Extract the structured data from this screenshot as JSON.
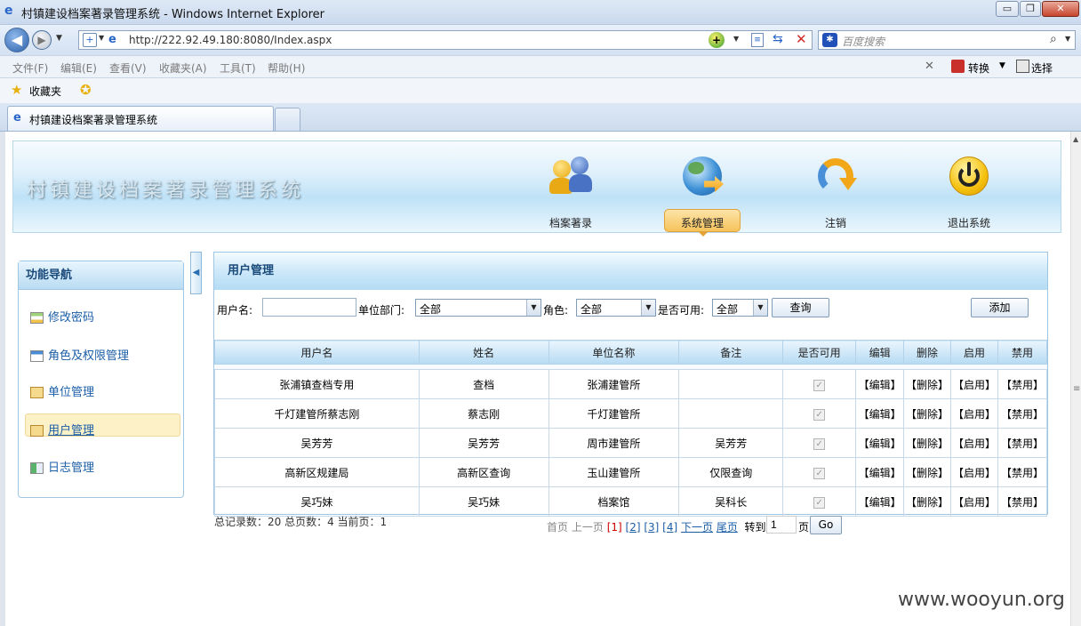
{
  "browser": {
    "window_title": "村镇建设档案著录管理系统 - Windows Internet Explorer",
    "url": "http://222.92.49.180:8080/Index.aspx",
    "search_placeholder": "百度搜索",
    "menu": [
      "文件(F)",
      "编辑(E)",
      "查看(V)",
      "收藏夹(A)",
      "工具(T)",
      "帮助(H)"
    ],
    "convert_label": "转换",
    "select_label": "选择",
    "favorites_label": "收藏夹",
    "tab_title": "村镇建设档案著录管理系统"
  },
  "header": {
    "system_name": "村镇建设档案著录管理系统",
    "nav": [
      {
        "label": "档案著录",
        "icon": "users-icon"
      },
      {
        "label": "系统管理",
        "icon": "globe-icon"
      },
      {
        "label": "注销",
        "icon": "refresh-arrow-icon"
      },
      {
        "label": "退出系统",
        "icon": "power-icon"
      }
    ],
    "active_nav": "系统管理"
  },
  "sidebar": {
    "title": "功能导航",
    "items": [
      {
        "label": "修改密码"
      },
      {
        "label": "角色及权限管理"
      },
      {
        "label": "单位管理"
      },
      {
        "label": "用户管理"
      },
      {
        "label": "日志管理"
      }
    ],
    "active": "用户管理"
  },
  "main": {
    "title": "用户管理",
    "filters": {
      "username_label": "用户名:",
      "username_value": "",
      "dept_label": "单位部门:",
      "dept_value": "全部",
      "role_label": "角色:",
      "role_value": "全部",
      "enabled_label": "是否可用:",
      "enabled_value": "全部",
      "query_button": "查询",
      "add_button": "添加"
    },
    "columns": [
      "用户名",
      "姓名",
      "单位名称",
      "备注",
      "是否可用",
      "编辑",
      "删除",
      "启用",
      "禁用"
    ],
    "action_labels": {
      "edit": "【编辑】",
      "delete": "【删除】",
      "enable": "【启用】",
      "disable": "【禁用】"
    },
    "rows": [
      {
        "username": "张浦镇查档专用",
        "name": "查档",
        "unit": "张浦建管所",
        "note": "",
        "enabled": true
      },
      {
        "username": "千灯建管所蔡志刚",
        "name": "蔡志刚",
        "unit": "千灯建管所",
        "note": "",
        "enabled": true
      },
      {
        "username": "吴芳芳",
        "name": "吴芳芳",
        "unit": "周市建管所",
        "note": "吴芳芳",
        "enabled": true
      },
      {
        "username": "高新区规建局",
        "name": "高新区查询",
        "unit": "玉山建管所",
        "note": "仅限查询",
        "enabled": true
      },
      {
        "username": "吴巧妹",
        "name": "吴巧妹",
        "unit": "档案馆",
        "note": "吴科长",
        "enabled": true
      }
    ],
    "summary": "总记录数：20 总页数：4 当前页：1",
    "pager": {
      "first": "首页",
      "prev": "上一页",
      "pages": [
        "[1]",
        "[2]",
        "[3]",
        "[4]"
      ],
      "current": "[1]",
      "next": "下一页",
      "last": "尾页",
      "goto_label": "转到",
      "goto_value": "1",
      "page_unit": "页",
      "go_button": "Go"
    }
  },
  "watermark": "www.wooyun.org"
}
